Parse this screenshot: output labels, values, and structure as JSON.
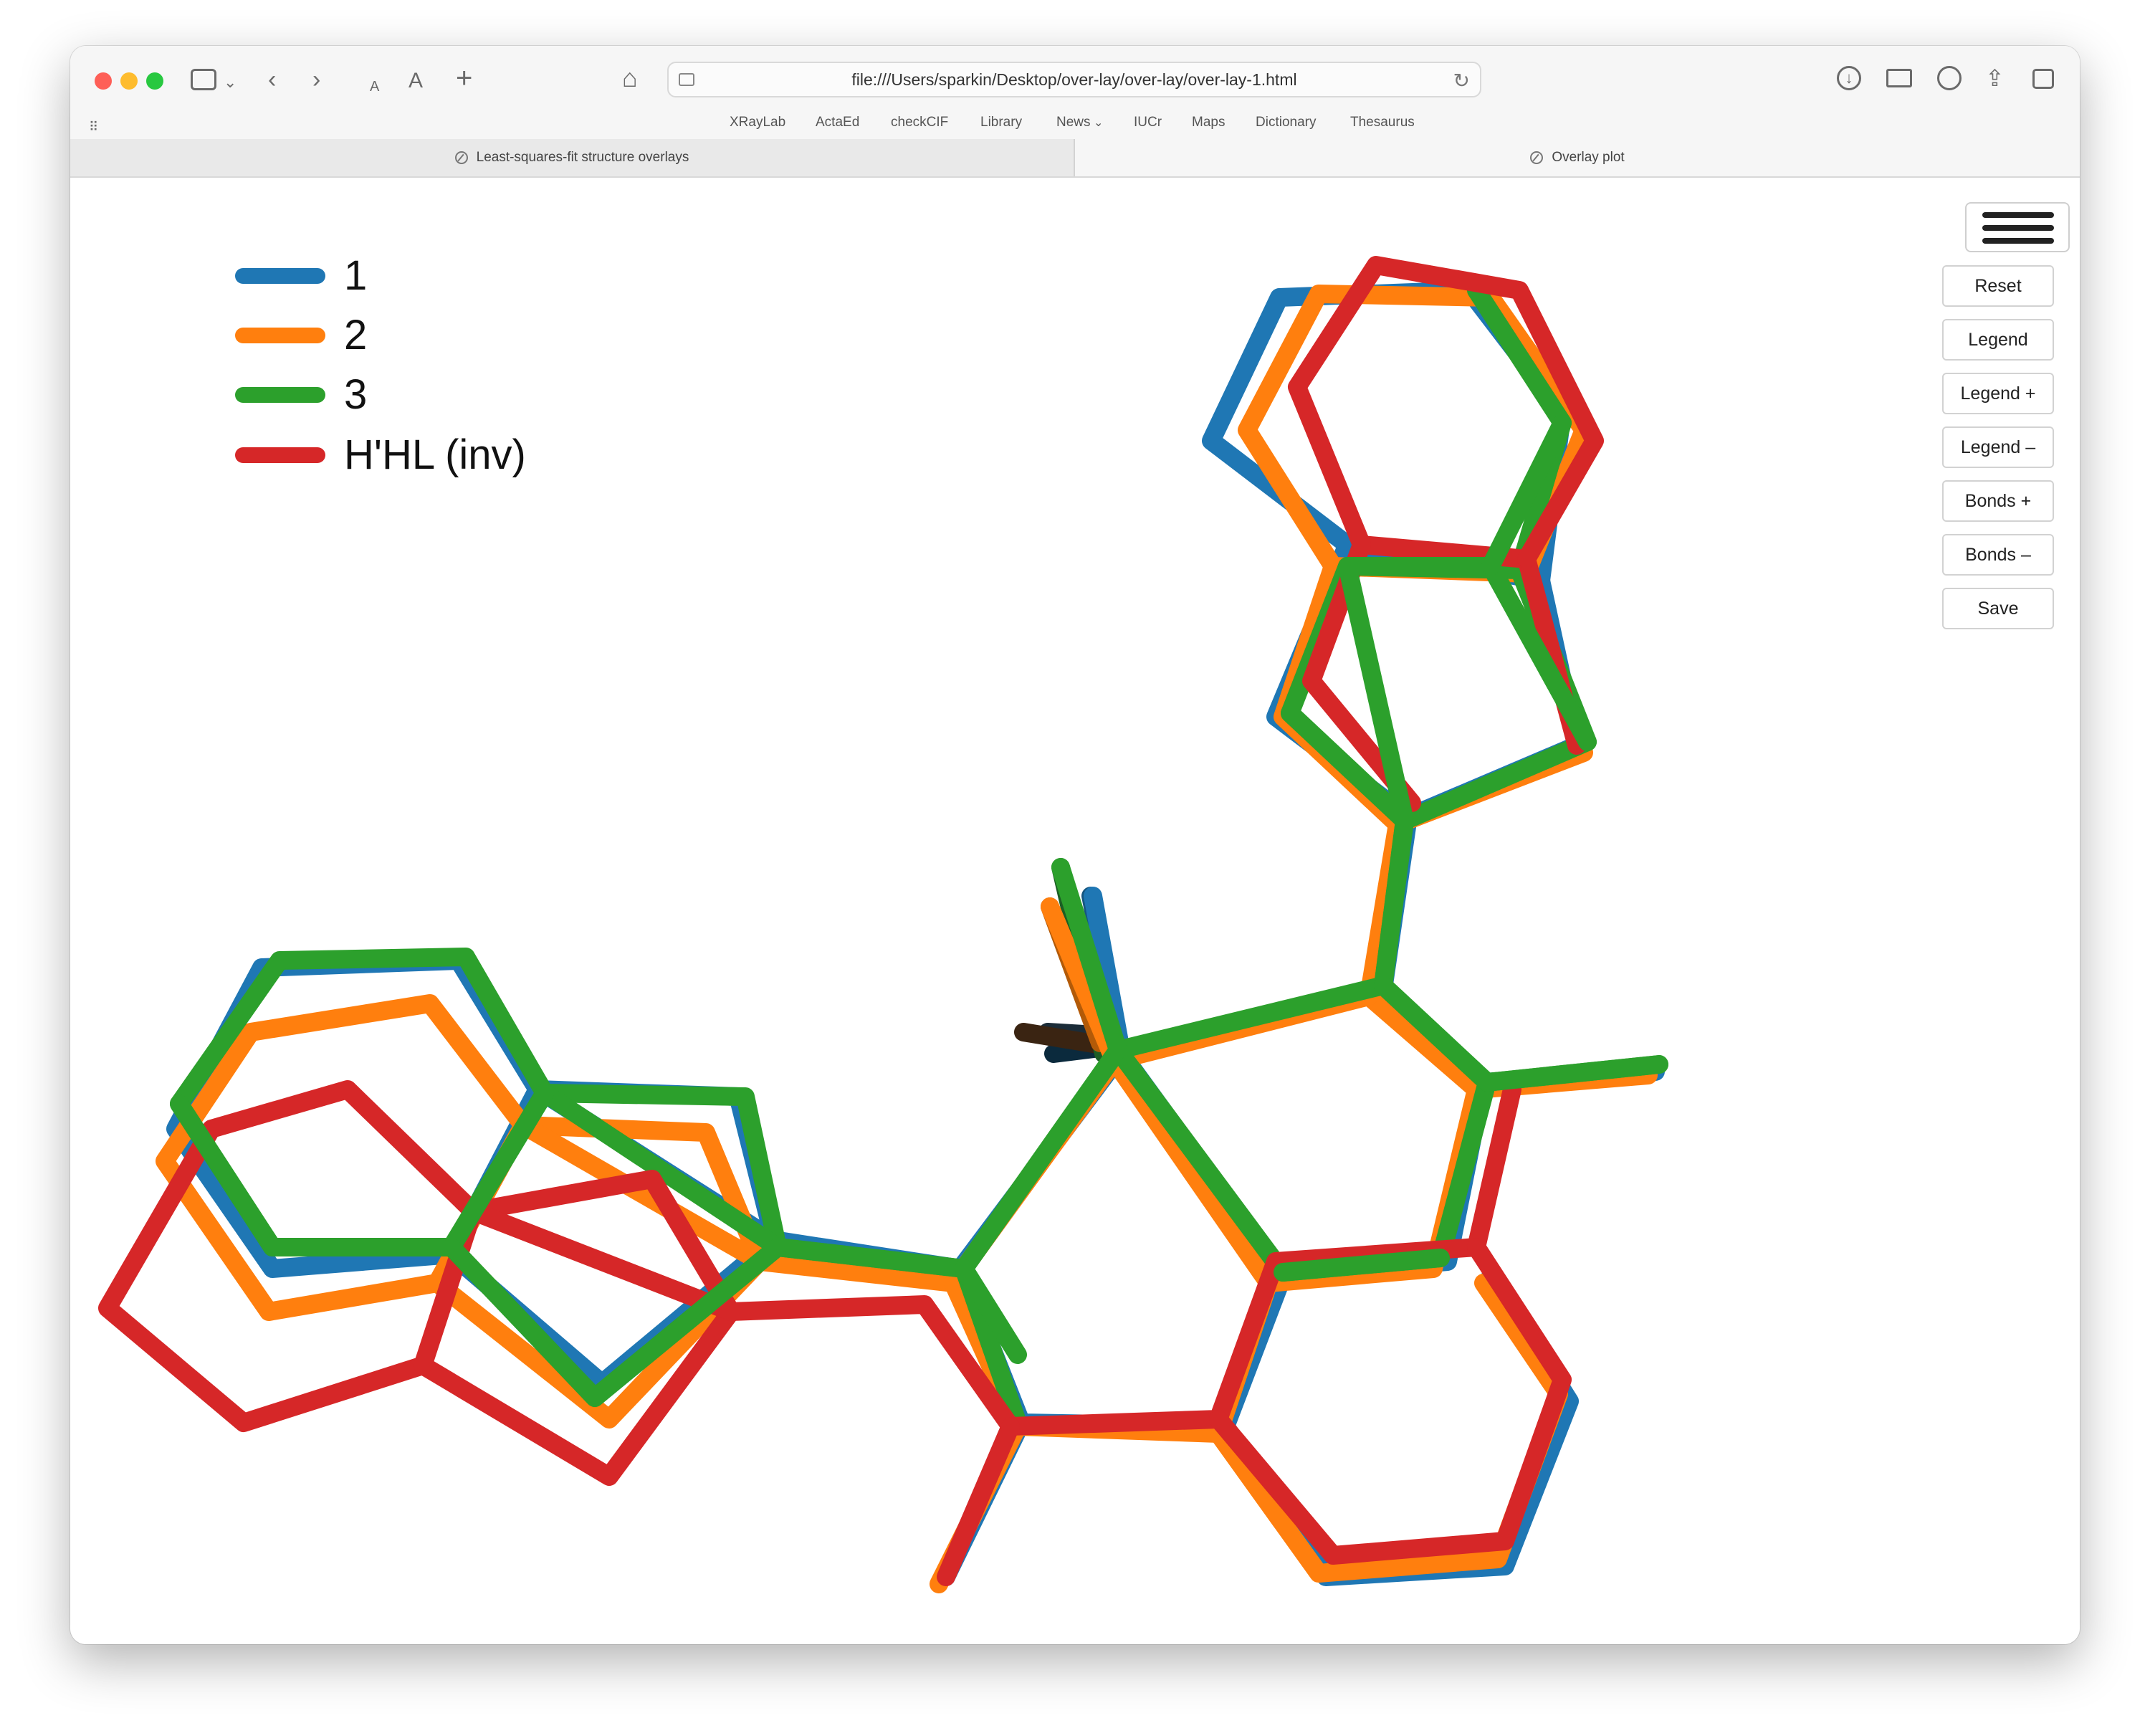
{
  "browser": {
    "url": "file:///Users/sparkin/Desktop/over-lay/over-lay/over-lay-1.html",
    "bookmarks": [
      "XRayLab",
      "ActaEd",
      "checkCIF",
      "Library",
      "News",
      "IUCr",
      "Maps",
      "Dictionary",
      "Thesaurus"
    ],
    "tabs": [
      {
        "title": "Least-squares-fit structure overlays",
        "active": false
      },
      {
        "title": "Overlay plot",
        "active": true
      }
    ]
  },
  "legend": {
    "entries": [
      {
        "label": "1",
        "color": "#1f77b4"
      },
      {
        "label": "2",
        "color": "#ff7f0e"
      },
      {
        "label": "3",
        "color": "#2ca02c"
      },
      {
        "label": "H'HL (inv)",
        "color": "#d62728"
      }
    ]
  },
  "controls": {
    "menu_icon": "hamburger-icon",
    "buttons": [
      "Reset",
      "Legend",
      "Legend +",
      "Legend –",
      "Bonds +",
      "Bonds –",
      "Save"
    ]
  }
}
